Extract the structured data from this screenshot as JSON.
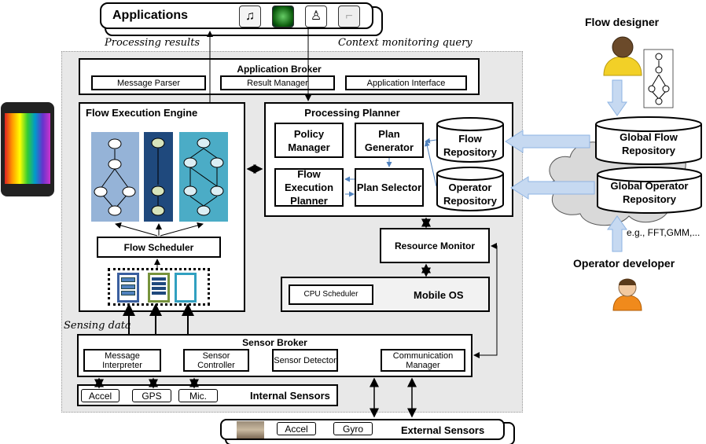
{
  "applications": {
    "title": "Applications",
    "icons": [
      "music-app-icon",
      "radar-app-icon",
      "exercise-app-icon",
      "posture-app-icon"
    ]
  },
  "labels": {
    "processing_results": "Processing results",
    "context_query": "Context monitoring query",
    "sensing_data": "Sensing data"
  },
  "app_broker": {
    "title": "Application Broker",
    "items": [
      "Message Parser",
      "Result Manager",
      "Application Interface"
    ]
  },
  "flow_engine": {
    "title": "Flow Execution Engine",
    "scheduler": "Flow Scheduler"
  },
  "planner": {
    "title": "Processing Planner",
    "policy": "Policy Manager",
    "generator": "Plan Generator",
    "exec_planner": "Flow Execution Planner",
    "selector": "Plan Selector",
    "flow_repo": "Flow Repository",
    "op_repo": "Operator Repository"
  },
  "resource_monitor": "Resource Monitor",
  "mobile_os": {
    "title": "Mobile OS",
    "cpu": "CPU Scheduler"
  },
  "sensor_broker": {
    "title": "Sensor Broker",
    "items": [
      "Message Interpreter",
      "Sensor Controller",
      "Sensor Detector",
      "Communication Manager"
    ]
  },
  "internal_sensors": {
    "title": "Internal Sensors",
    "items": [
      "Accel",
      "GPS",
      "Mic."
    ]
  },
  "external_sensors": {
    "title": "External Sensors",
    "items": [
      "Accel",
      "Gyro"
    ]
  },
  "cloud": {
    "flow_designer": "Flow designer",
    "global_flow": "Global Flow Repository",
    "global_op": "Global Operator Repository",
    "examples": "e.g., FFT,GMM,...",
    "operator_developer": "Operator developer"
  },
  "colors": {
    "panel1": "#95b3d7",
    "panel2": "#1f497d",
    "panel3": "#4bacc6",
    "arrow_fill": "#c6d9f1",
    "area": "#e8e8e8"
  }
}
